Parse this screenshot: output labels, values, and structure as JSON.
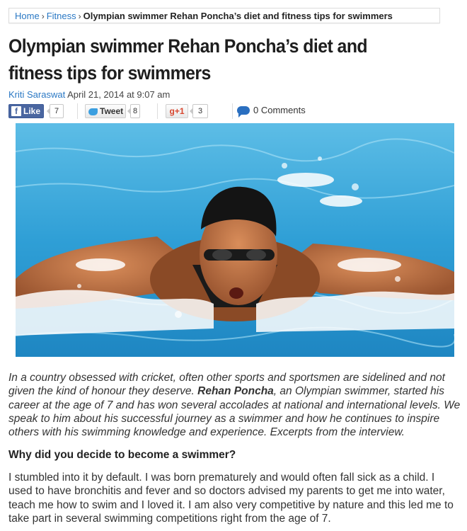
{
  "breadcrumb": {
    "home": "Home",
    "sep": "›",
    "category": "Fitness",
    "current": "Olympian swimmer Rehan Poncha’s diet and fitness tips for swimmers"
  },
  "article": {
    "title": "Olympian swimmer Rehan Poncha’s diet and fitness tips for swimmers",
    "author": "Kriti Saraswat",
    "date": "April 21, 2014 at 9:07 am"
  },
  "share": {
    "facebook_label": "Like",
    "facebook_count": "7",
    "twitter_label": "Tweet",
    "twitter_count": "8",
    "gplus_label": "g+1",
    "gplus_count": "3",
    "comments": "0 Comments"
  },
  "body": {
    "intro_pre": "In a country obsessed with cricket, often other sports and sportsmen are sidelined and not given the kind of honour they deserve. ",
    "intro_name": "Rehan Poncha",
    "intro_post": ", an Olympian swimmer, started his career at the age of 7 and has won several accolades at national and international levels. We speak to him about his successful journey as a swimmer and how he continues to inspire others with his swimming knowledge and experience. Excerpts from the interview.",
    "question": "Why did you decide to become a swimmer?",
    "answer": "I stumbled into it by default. I was born prematurely and would often fall sick as a child. I used to have bronchitis and fever and so doctors advised my parents to get me into water, teach me how to swim and I loved it. I am also very competitive by nature and this led me to take part in several swimming competitions right from the age of 7."
  },
  "colors": {
    "link": "#2a78c4",
    "facebook": "#4a66a0",
    "water": "#3aa6d8"
  }
}
